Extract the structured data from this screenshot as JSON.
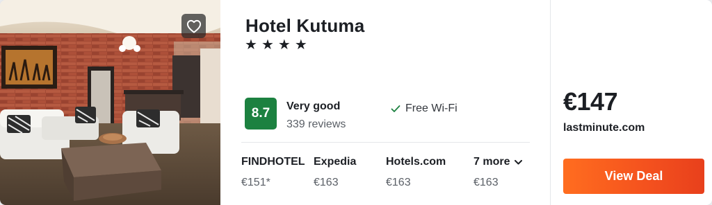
{
  "hotel": {
    "name": "Hotel Kutuma",
    "stars": [
      "★",
      "★",
      "★",
      "★"
    ],
    "rating": {
      "score": "8.7",
      "label": "Very good",
      "reviews": "339 reviews",
      "color": "#1c8140"
    },
    "amenity": {
      "icon": "checkmark-icon",
      "label": "Free Wi-Fi"
    },
    "favorite_icon": "heart-icon"
  },
  "providers": [
    {
      "name": "FINDHOTEL",
      "price": "€151*"
    },
    {
      "name": "Expedia",
      "price": "€163"
    },
    {
      "name": "Hotels.com",
      "price": "€163"
    },
    {
      "name": "7 more",
      "price": "€163",
      "icon": "chevron-down-icon"
    }
  ],
  "deal": {
    "price": "€147",
    "site": "lastminute.com",
    "button_label": "View Deal",
    "button_color": "#f4511e"
  }
}
